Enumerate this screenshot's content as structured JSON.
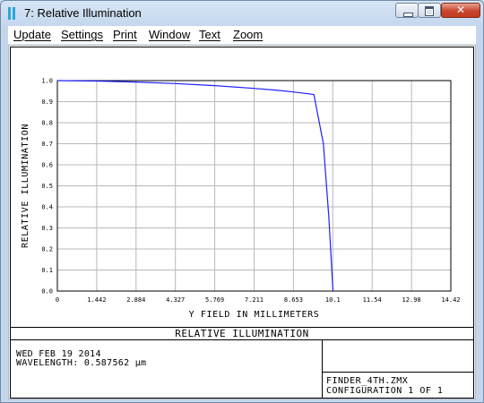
{
  "window": {
    "title": "7: Relative Illumination"
  },
  "menu": [
    "Update",
    "Settings",
    "Print",
    "Window",
    "Text",
    "Zoom"
  ],
  "report": {
    "banner": "RELATIVE ILLUMINATION",
    "date": "WED FEB 19 2014",
    "wavelength": "WAVELENGTH: 0.587562 µm",
    "file": "FINDER_4TH.ZMX",
    "configuration": "CONFIGURATION 1 OF 1"
  },
  "chart_data": {
    "type": "line",
    "title": "",
    "xlabel": "Y FIELD IN MILLIMETERS",
    "ylabel": "RELATIVE ILLUMINATION",
    "xlim": [
      0,
      14.42
    ],
    "ylim": [
      0.0,
      1.0
    ],
    "x_ticks": [
      "0",
      "1.442",
      "2.884",
      "4.327",
      "5.769",
      "7.211",
      "8.653",
      "10.1",
      "11.54",
      "12.98",
      "14.42"
    ],
    "y_ticks": [
      "0.0",
      "0.1",
      "0.2",
      "0.3",
      "0.4",
      "0.5",
      "0.6",
      "0.7",
      "0.8",
      "0.9",
      "1.0"
    ],
    "grid": true,
    "line_color": "#1f1fff",
    "series": [
      {
        "name": "",
        "x": [
          0,
          1.442,
          2.884,
          4.327,
          5.769,
          7.211,
          8.0,
          8.653,
          9.4,
          9.75,
          9.95,
          10.1
        ],
        "y": [
          1.0,
          0.998,
          0.993,
          0.986,
          0.976,
          0.963,
          0.955,
          0.946,
          0.934,
          0.7,
          0.35,
          0.0
        ]
      }
    ]
  }
}
